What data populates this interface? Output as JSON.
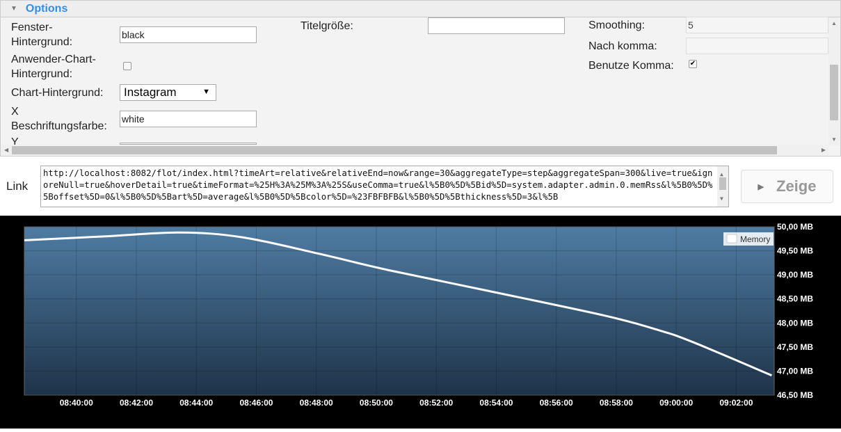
{
  "options": {
    "title": "Options",
    "fields": {
      "window_bg": {
        "label": "Fenster-\nHintergrund:",
        "value": "black"
      },
      "custom_chart_bg": {
        "label": "Anwender-Chart-\nHintergrund:",
        "checked": false
      },
      "chart_bg": {
        "label": "Chart-Hintergrund:",
        "value": "Instagram"
      },
      "x_label_color": {
        "label": "X\nBeschriftungsfarbe:",
        "value": "white"
      },
      "y_label_color": {
        "label": "Y"
      },
      "title_size": {
        "label": "Titelgröße:",
        "value": ""
      },
      "smoothing": {
        "label": "Smoothing:",
        "value": "5"
      },
      "after_comma": {
        "label": "Nach komma:",
        "value": ""
      },
      "use_comma": {
        "label": "Benutze Komma:",
        "checked": true
      }
    }
  },
  "link": {
    "label": "Link",
    "value": "http://localhost:8082/flot/index.html?timeArt=relative&relativeEnd=now&range=30&aggregateType=step&aggregateSpan=300&live=true&ignoreNull=true&hoverDetail=true&timeFormat=%25H%3A%25M%3A%25S&useComma=true&l%5B0%5D%5Bid%5D=system.adapter.admin.0.memRss&l%5B0%5D%5Boffset%5D=0&l%5B0%5D%5Bart%5D=average&l%5B0%5D%5Bcolor%5D=%23FBFBFB&l%5B0%5D%5Bthickness%5D=3&l%5B"
  },
  "show_button": {
    "label": "Zeige"
  },
  "chart_data": {
    "type": "line",
    "series": [
      {
        "name": "Memory",
        "color": "#FBFBFB",
        "x": [
          "08:38:16",
          "08:40:55",
          "08:43:28",
          "08:45:33",
          "08:48:05",
          "08:50:24",
          "08:53:38",
          "08:57:34",
          "08:59:25",
          "09:00:34",
          "09:03:11"
        ],
        "y": [
          49.72,
          49.8,
          49.88,
          49.78,
          49.44,
          49.1,
          48.68,
          48.16,
          47.85,
          47.6,
          46.91
        ]
      }
    ],
    "xticks": [
      "08:40:00",
      "08:42:00",
      "08:44:00",
      "08:46:00",
      "08:48:00",
      "08:50:00",
      "08:52:00",
      "08:54:00",
      "08:56:00",
      "08:58:00",
      "09:00:00",
      "09:02:00"
    ],
    "yticks": [
      "50,00 MB",
      "49,50 MB",
      "49,00 MB",
      "48,50 MB",
      "48,00 MB",
      "47,50 MB",
      "47,00 MB",
      "46,50 MB"
    ],
    "ylim": [
      46.5,
      50.0
    ],
    "xlim": [
      "08:38:16",
      "09:03:16"
    ],
    "legend_position": "top-right",
    "grid": true,
    "background": "#000000",
    "plot_gradient": [
      "#4f7ca3",
      "#1e3349"
    ]
  }
}
